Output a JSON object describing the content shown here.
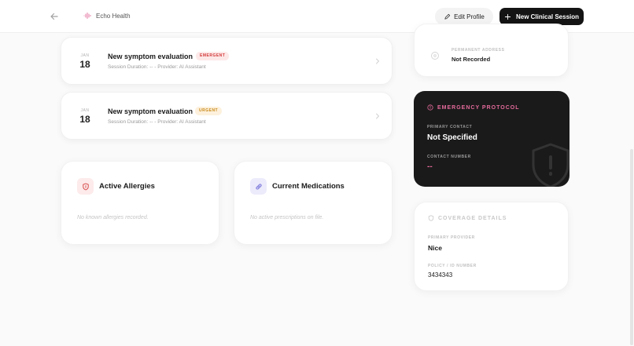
{
  "header": {
    "brand_name": "Echo Health",
    "edit_profile_label": "Edit Profile",
    "new_session_label": "New Clinical Session"
  },
  "sessions": [
    {
      "month": "JAN",
      "day": "18",
      "title": "New symptom evaluation",
      "badge": "EMERGENT",
      "meta": "Session Duration: -- - Provider: AI Assistant"
    },
    {
      "month": "JAN",
      "day": "18",
      "title": "New symptom evaluation",
      "badge": "URGENT",
      "meta": "Session Duration: -- - Provider: AI Assistant"
    }
  ],
  "allergies": {
    "title": "Active Allergies",
    "empty": "No known allergies recorded."
  },
  "medications": {
    "title": "Current Medications",
    "empty": "No active prescriptions on file."
  },
  "address": {
    "label": "PERMANENT ADDRESS",
    "value": "Not Recorded"
  },
  "emergency": {
    "title": "EMERGENCY PROTOCOL",
    "primary_contact_label": "PRIMARY CONTACT",
    "primary_contact_value": "Not Specified",
    "contact_number_label": "CONTACT NUMBER",
    "contact_number_value": "--"
  },
  "coverage": {
    "title": "COVERAGE DETAILS",
    "provider_label": "PRIMARY PROVIDER",
    "provider_value": "Nice",
    "policy_label": "POLICY / ID NUMBER",
    "policy_value": "3434343"
  },
  "colors": {
    "emergent_badge": "#d33a3a",
    "urgent_badge": "#c98a1b",
    "emergency_accent": "#e46a9a",
    "dark_card": "#1a1a1a"
  }
}
